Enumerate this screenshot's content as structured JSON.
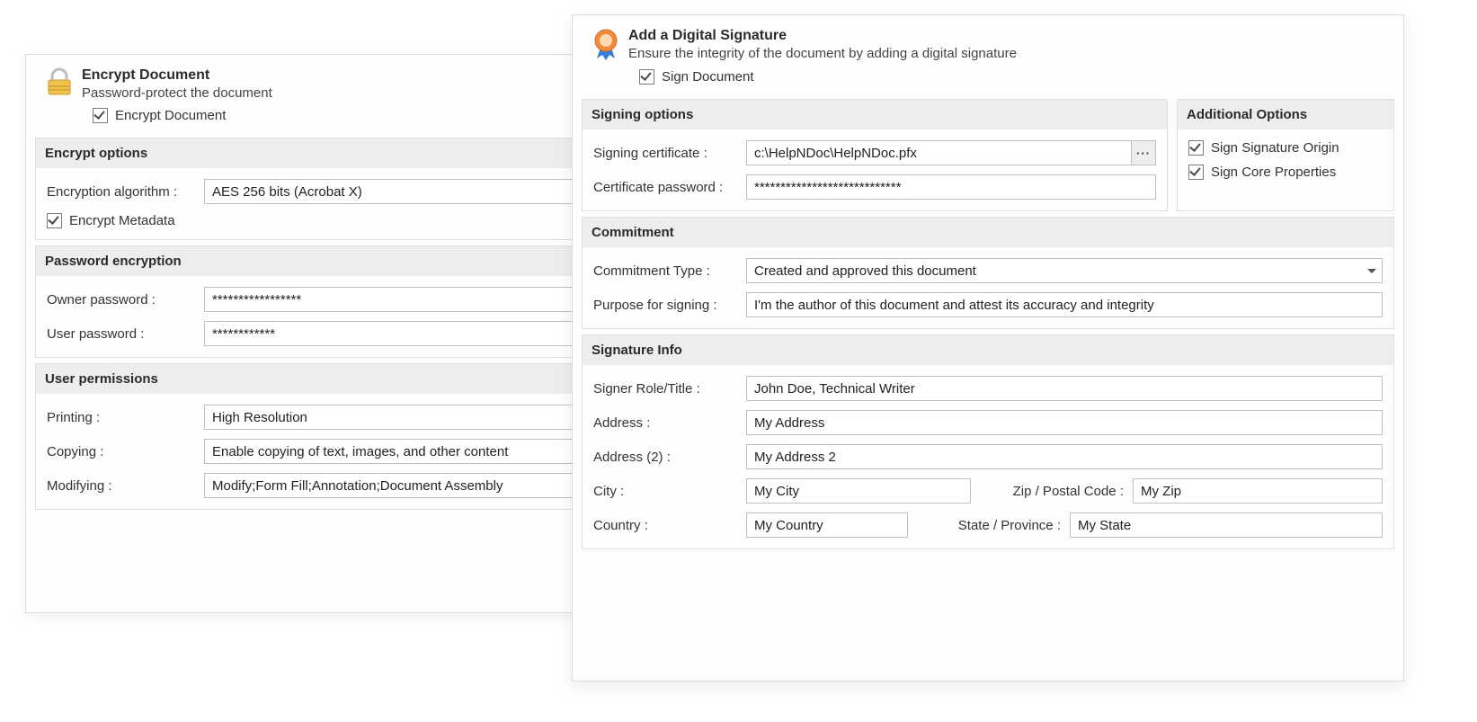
{
  "encrypt": {
    "title": "Encrypt Document",
    "subtitle": "Password-protect the document",
    "checkbox_label": "Encrypt Document",
    "options_title": "Encrypt options",
    "algorithm_label": "Encryption algorithm :",
    "algorithm_value": "AES 256 bits (Acrobat X)",
    "encrypt_metadata_label": "Encrypt Metadata",
    "password_section_title": "Password encryption",
    "owner_pwd_label": "Owner password :",
    "owner_pwd_value": "*****************",
    "user_pwd_label": "User password :",
    "user_pwd_value": "************",
    "permissions_title": "User permissions",
    "printing_label": "Printing :",
    "printing_value": "High Resolution",
    "copying_label": "Copying :",
    "copying_value": "Enable copying of text, images, and other content",
    "modifying_label": "Modifying :",
    "modifying_value": "Modify;Form Fill;Annotation;Document Assembly"
  },
  "sign": {
    "title": "Add a Digital Signature",
    "subtitle": "Ensure the integrity of the document by adding a digital signature",
    "checkbox_label": "Sign Document",
    "signing_options_title": "Signing options",
    "additional_options_title": "Additional Options",
    "cert_label": "Signing certificate :",
    "cert_value": "c:\\HelpNDoc\\HelpNDoc.pfx",
    "cert_pwd_label": "Certificate password :",
    "cert_pwd_value": "****************************",
    "opt_sign_origin": "Sign Signature Origin",
    "opt_sign_core": "Sign Core Properties",
    "commitment_title": "Commitment",
    "commitment_type_label": "Commitment Type :",
    "commitment_type_value": "Created and approved this document",
    "purpose_label": "Purpose for signing :",
    "purpose_value": "I'm the author of this document and attest its accuracy and integrity",
    "siginfo_title": "Signature Info",
    "role_label": "Signer Role/Title :",
    "role_value": "John Doe, Technical Writer",
    "addr_label": "Address :",
    "addr_value": "My Address",
    "addr2_label": "Address (2) :",
    "addr2_value": "My Address 2",
    "city_label": "City :",
    "city_value": "My City",
    "zip_label": "Zip / Postal Code :",
    "zip_value": "My Zip",
    "country_label": "Country :",
    "country_value": "My Country",
    "state_label": "State / Province :",
    "state_value": "My State"
  },
  "icons": {
    "browse_dots": "···"
  }
}
